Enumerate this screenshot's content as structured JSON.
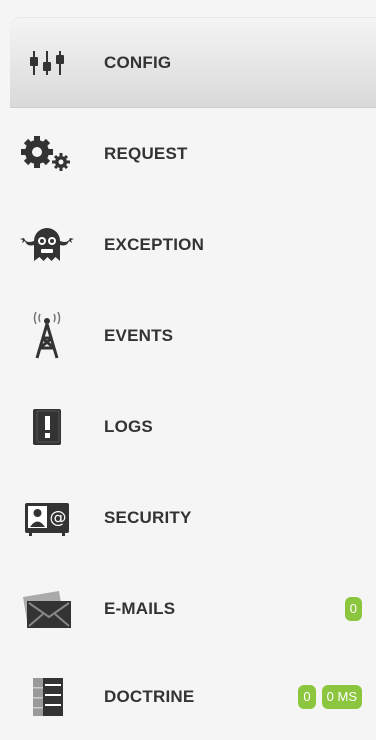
{
  "menu": {
    "items": [
      {
        "label": "CONFIG",
        "icon": "config-sliders-icon",
        "active": true
      },
      {
        "label": "REQUEST",
        "icon": "gears-icon"
      },
      {
        "label": "EXCEPTION",
        "icon": "ghost-icon"
      },
      {
        "label": "EVENTS",
        "icon": "radio-tower-icon"
      },
      {
        "label": "LOGS",
        "icon": "log-book-icon"
      },
      {
        "label": "SECURITY",
        "icon": "id-card-icon"
      },
      {
        "label": "E-MAILS",
        "icon": "envelope-icon",
        "badges": [
          "0"
        ]
      },
      {
        "label": "DOCTRINE",
        "icon": "database-server-icon",
        "badges": [
          "0",
          "0 MS"
        ]
      }
    ]
  },
  "colors": {
    "badge": "#8cc63f",
    "label": "#333333",
    "background": "#f5f5f5"
  }
}
